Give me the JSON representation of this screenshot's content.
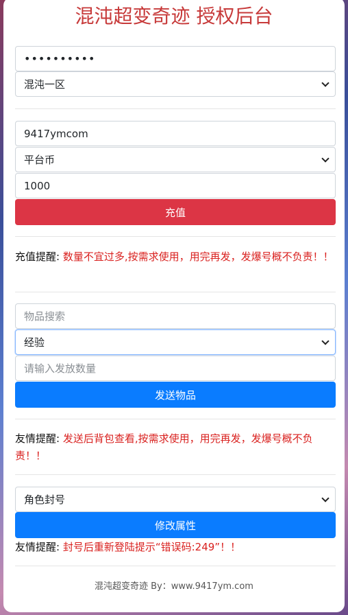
{
  "title": "混沌超变奇迹 授权后台",
  "login": {
    "password_masked": "••••••••••",
    "server_selected": "混沌一区"
  },
  "recharge": {
    "account_value": "9417ymcom",
    "currency_selected": "平台币",
    "amount_value": "1000",
    "button_label": "充值",
    "tip_label": "充值提醒:",
    "tip_text": "数量不宜过多,按需求使用，用完再发，发爆号概不负责！！"
  },
  "items": {
    "search_placeholder": "物品搜索",
    "category_selected": "经验",
    "quantity_placeholder": "请输入发放数量",
    "button_label": "发送物品",
    "tip_label": "友情提醒:",
    "tip_text": "发送后背包查看,按需求使用，用完再发，发爆号概不负责！！"
  },
  "attribute": {
    "action_selected": "角色封号",
    "button_label": "修改属性",
    "tip_label": "友情提醒:",
    "tip_text": "封号后重新登陆提示“错误码:249”！！"
  },
  "footer": "混沌超变奇迹 By：www.9417ym.com",
  "colors": {
    "title": "#c73a3a",
    "danger": "#dc3545",
    "primary": "#0a7cff",
    "warning_text": "#d9211f"
  }
}
